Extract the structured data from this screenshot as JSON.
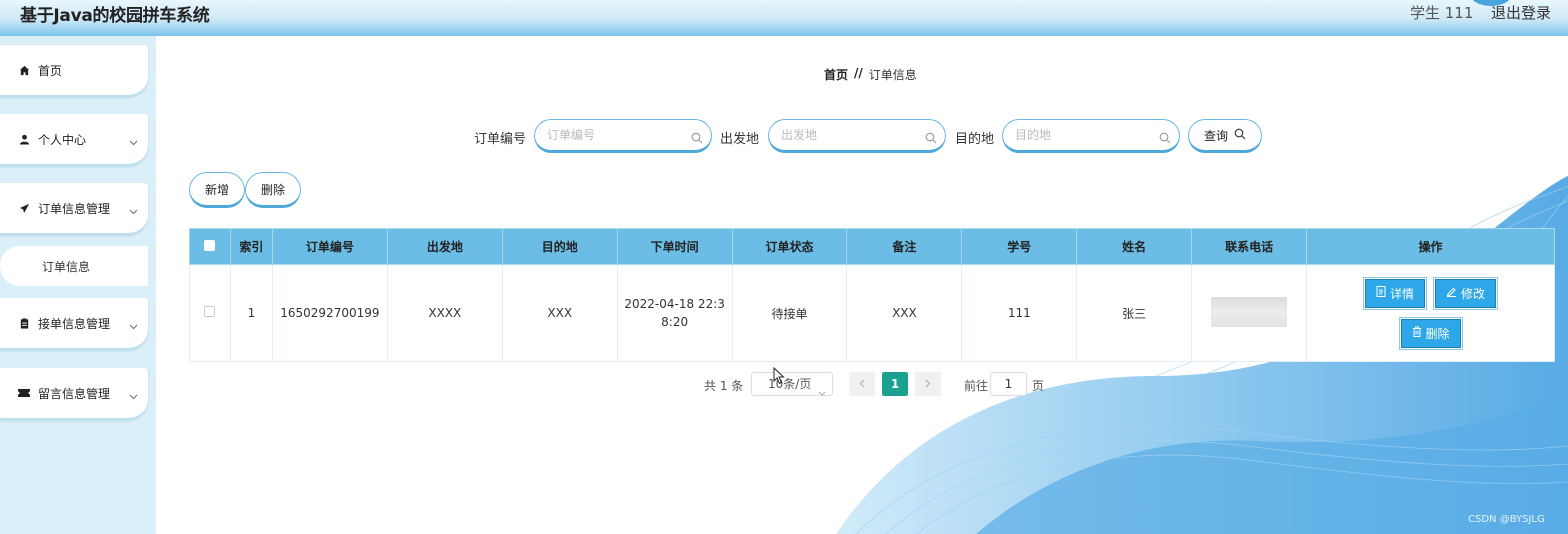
{
  "header": {
    "title": "基于Java的校园拼车系统",
    "user": "学生 111",
    "logout": "退出登录"
  },
  "sidebar": {
    "items": [
      {
        "label": "首页",
        "icon": "home-icon"
      },
      {
        "label": "个人中心",
        "icon": "person-icon"
      },
      {
        "label": "订单信息管理",
        "icon": "send-icon"
      },
      {
        "label": "订单信息",
        "icon": ""
      },
      {
        "label": "接单信息管理",
        "icon": "clipboard-icon"
      },
      {
        "label": "留言信息管理",
        "icon": "ticket-icon"
      }
    ]
  },
  "breadcrumb": {
    "home": "首页",
    "separator": "//",
    "current": "订单信息"
  },
  "search": {
    "order_no_label": "订单编号",
    "order_no_placeholder": "订单编号",
    "origin_label": "出发地",
    "origin_placeholder": "出发地",
    "dest_label": "目的地",
    "dest_placeholder": "目的地",
    "query_label": "查询"
  },
  "actions": {
    "add": "新增",
    "delete": "删除"
  },
  "table": {
    "columns": [
      "索引",
      "订单编号",
      "出发地",
      "目的地",
      "下单时间",
      "订单状态",
      "备注",
      "学号",
      "姓名",
      "联系电话",
      "操作"
    ],
    "rows": [
      {
        "index": "1",
        "order_no": "1650292700199",
        "origin": "XXXX",
        "dest": "XXX",
        "time": "2022-04-18 22:3\n8:20",
        "status": "待接单",
        "remark": "XXX",
        "student_no": "111",
        "name": "张三",
        "phone": ""
      }
    ],
    "row_actions": {
      "detail": "详情",
      "edit": "修改",
      "delete": "删除"
    }
  },
  "pagination": {
    "total": "共 1 条",
    "page_size": "10条/页",
    "current_page": "1",
    "goto_label": "前往",
    "goto_value": "1",
    "page_suffix": "页"
  },
  "watermark": "CSDN @BYSJLG",
  "colors": {
    "header_bottom": "#7cc3ea",
    "sidebar_bg": "#dbeff8",
    "table_head": "#6bbde5",
    "op_button": "#2ea7e8",
    "active_page": "#1aa290"
  }
}
